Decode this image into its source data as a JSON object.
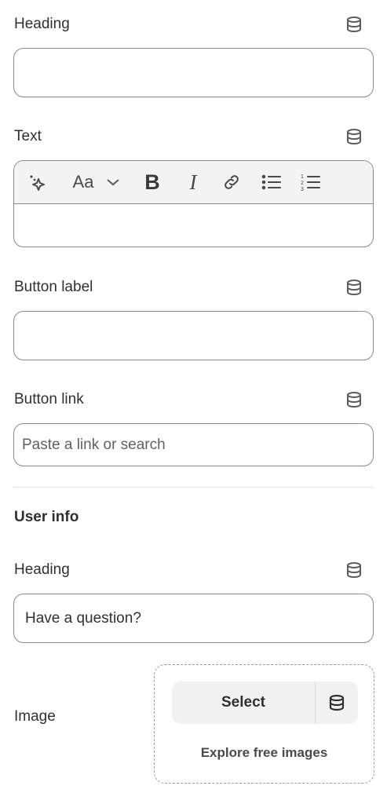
{
  "fields": {
    "heading": {
      "label": "Heading",
      "value": "",
      "icon": "database-icon"
    },
    "text": {
      "label": "Text",
      "icon": "database-icon"
    },
    "button_label": {
      "label": "Button label",
      "value": "",
      "icon": "database-icon"
    },
    "button_link": {
      "label": "Button link",
      "placeholder": "Paste a link or search",
      "icon": "database-icon"
    }
  },
  "toolbar": {
    "font_label": "Aa",
    "bold_label": "B",
    "italic_label": "I",
    "icons": [
      "sparkle-icon",
      "chevron-down-icon",
      "link-icon",
      "bullet-list-icon",
      "numbered-list-icon"
    ]
  },
  "user_info": {
    "section_title": "User info",
    "heading": {
      "label": "Heading",
      "value": "Have a question?",
      "icon": "database-icon"
    },
    "image": {
      "label": "Image",
      "select_label": "Select",
      "explore_label": "Explore free images"
    }
  }
}
